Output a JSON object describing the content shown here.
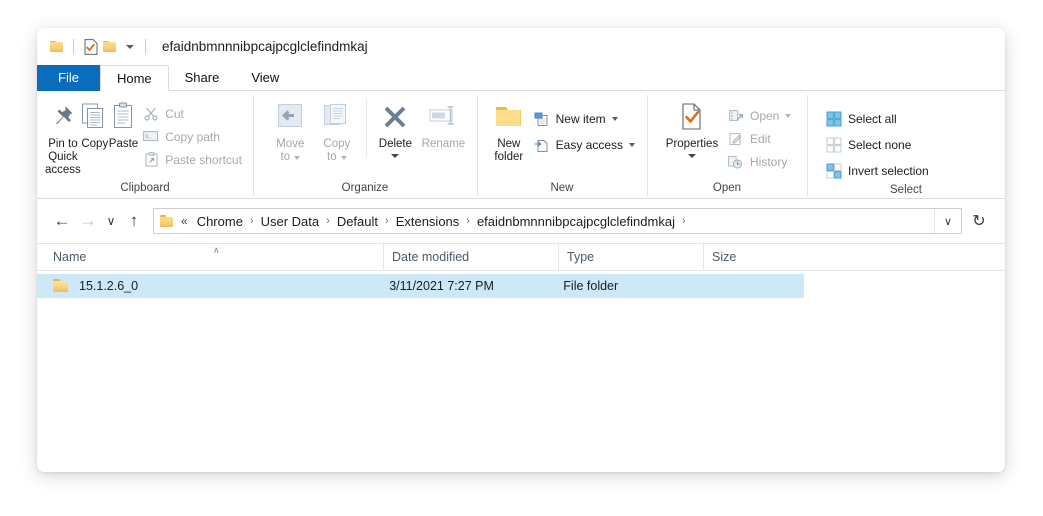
{
  "window": {
    "title": "efaidnbmnnnibpcajpcglclefindmkaj",
    "quick_access": [
      {
        "name": "folder-icon",
        "label": "Explorer"
      },
      {
        "name": "properties-icon",
        "label": "Properties"
      },
      {
        "name": "new-folder-icon",
        "label": "New folder"
      },
      {
        "name": "customize-caret-icon",
        "label": "Customize Quick Access Toolbar"
      }
    ]
  },
  "tabs": [
    {
      "label": "File",
      "state": "file"
    },
    {
      "label": "Home",
      "state": "active"
    },
    {
      "label": "Share",
      "state": "normal"
    },
    {
      "label": "View",
      "state": "normal"
    }
  ],
  "ribbon": {
    "groups": [
      {
        "label": "Clipboard",
        "big_buttons": [
          {
            "label": "Pin to Quick\naccess",
            "label_line1": "Pin to Quick",
            "label_line2": "access",
            "icon": "pin-icon",
            "enabled": true
          },
          {
            "label": "Copy",
            "icon": "copy-icon",
            "enabled": true
          },
          {
            "label": "Paste",
            "icon": "paste-icon",
            "enabled": true
          }
        ],
        "small_buttons": [
          {
            "label": "Cut",
            "icon": "scissors-icon",
            "enabled": false
          },
          {
            "label": "Copy path",
            "icon": "copy-path-icon",
            "enabled": false
          },
          {
            "label": "Paste shortcut",
            "icon": "paste-shortcut-icon",
            "enabled": false
          }
        ]
      },
      {
        "label": "Organize",
        "big_buttons": [
          {
            "label_line1": "Move",
            "label_line2": "to",
            "icon": "move-to-icon",
            "enabled": false,
            "has_caret": true
          },
          {
            "label_line1": "Copy",
            "label_line2": "to",
            "icon": "copy-to-icon",
            "enabled": false,
            "has_caret": true
          },
          {
            "label": "Delete",
            "icon": "delete-x-icon",
            "enabled": true,
            "has_dropdown": true
          },
          {
            "label": "Rename",
            "icon": "rename-icon",
            "enabled": false
          }
        ],
        "small_buttons": []
      },
      {
        "label": "New",
        "big_buttons": [
          {
            "label_line1": "New",
            "label_line2": "folder",
            "icon": "new-folder-icon",
            "enabled": true
          }
        ],
        "small_buttons": [
          {
            "label": "New item",
            "icon": "new-item-icon",
            "enabled": true,
            "has_caret": true
          },
          {
            "label": "Easy access",
            "icon": "easy-access-icon",
            "enabled": true,
            "has_caret": true
          }
        ]
      },
      {
        "label": "Open",
        "big_buttons": [
          {
            "label": "Properties",
            "icon": "properties-icon",
            "enabled": true,
            "has_dropdown": true
          }
        ],
        "small_buttons": [
          {
            "label": "Open",
            "icon": "open-icon",
            "enabled": false,
            "has_caret": true
          },
          {
            "label": "Edit",
            "icon": "edit-icon",
            "enabled": false
          },
          {
            "label": "History",
            "icon": "history-icon",
            "enabled": false
          }
        ]
      },
      {
        "label": "Select",
        "big_buttons": [],
        "small_buttons": [
          {
            "label": "Select all",
            "icon": "select-all-icon",
            "enabled": true
          },
          {
            "label": "Select none",
            "icon": "select-none-icon",
            "enabled": true
          },
          {
            "label": "Invert selection",
            "icon": "invert-selection-icon",
            "enabled": true
          }
        ]
      }
    ]
  },
  "addressbar": {
    "back": {
      "name": "back-arrow-icon",
      "glyph": "←",
      "enabled": true
    },
    "forward": {
      "name": "forward-arrow-icon",
      "glyph": "→",
      "enabled": false
    },
    "recent": {
      "name": "recent-locations-chevron-icon",
      "glyph": "∨",
      "enabled": true
    },
    "up": {
      "name": "up-arrow-icon",
      "glyph": "↑",
      "enabled": true
    },
    "overflow": "«",
    "breadcrumbs": [
      "Chrome",
      "User Data",
      "Default",
      "Extensions",
      "efaidnbmnnnibpcajpcglclefindmkaj"
    ],
    "separator": "›",
    "dropdown_glyph": "∨",
    "refresh_glyph": "↻"
  },
  "columns": [
    {
      "label": "Name",
      "sorted": "asc",
      "sort_glyph": "∧"
    },
    {
      "label": "Date modified",
      "sorted": ""
    },
    {
      "label": "Type",
      "sorted": ""
    },
    {
      "label": "Size",
      "sorted": ""
    }
  ],
  "files": [
    {
      "name": "15.1.2.6_0",
      "date_modified": "3/11/2021 7:27 PM",
      "type": "File folder",
      "size": "",
      "icon": "folder-icon",
      "selected": true
    }
  ],
  "colors": {
    "file_tab_blue": "#0a6cbd",
    "selection_blue": "#cde8f7",
    "folder_yellow": "#f5d173",
    "header_text": "#4a5a6a",
    "accent_orange": "#e06c16"
  }
}
